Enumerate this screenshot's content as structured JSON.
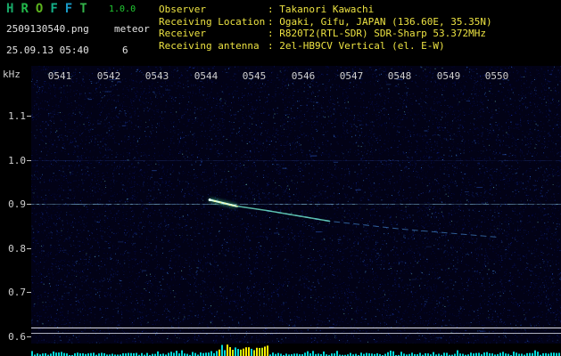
{
  "app": {
    "title_letters": [
      {
        "ch": "H",
        "color": "#18a868"
      },
      {
        "ch": "R",
        "color": "#22b84a"
      },
      {
        "ch": "O",
        "color": "#5cb41e"
      },
      {
        "ch": "F",
        "color": "#14b088"
      },
      {
        "ch": "F",
        "color": "#1898c4"
      },
      {
        "ch": "T",
        "color": "#34b44a"
      }
    ],
    "version": "1.0.0",
    "version_color": "#22cc33",
    "filename": "2509130540.png",
    "mode_label": "meteor",
    "datetime": "25.09.13 05:40",
    "event_count": "6"
  },
  "info": {
    "rows": [
      {
        "label": "Observer",
        "value": ": Takanori Kawachi"
      },
      {
        "label": "Receiving Location",
        "value": ": Ogaki, Gifu, JAPAN (136.60E, 35.35N)"
      },
      {
        "label": "Receiver",
        "value": ": R820T2(RTL-SDR) SDR-Sharp 53.372MHz"
      },
      {
        "label": "Receiving antenna",
        "value": ": 2el-HB9CV Vertical (el. E-W)"
      }
    ]
  },
  "spectrogram": {
    "freq_unit": "kHz",
    "time_labels": [
      "0541",
      "0542",
      "0543",
      "0544",
      "0545",
      "0546",
      "0547",
      "0548",
      "0549",
      "0550"
    ],
    "freq_labels": [
      "1.1",
      "1.0",
      "0.9",
      "0.8",
      "0.7",
      "0.6"
    ],
    "carrier_line_khz": 0.9,
    "faint_line_khz": 1.0,
    "calibration_lines_khz": [
      0.621,
      0.609
    ],
    "echo": {
      "points_time_khz": [
        [
          4.08,
          0.91
        ],
        [
          4.62,
          0.897
        ],
        [
          5.25,
          0.886
        ],
        [
          6.55,
          0.863
        ],
        [
          8.05,
          0.843
        ],
        [
          10.02,
          0.826
        ]
      ]
    },
    "colors": {
      "background": "#020216",
      "noise_blue": "#1424a0",
      "carrier": "#8cd2ff",
      "echo_head": "#d8ffe8",
      "echo_mid": "#6ee6c8",
      "echo_tail": "#55aaff",
      "calibration": "#e6e6ea",
      "axis_text": "#cfcfcf"
    },
    "activity_strip": {
      "bar_color": "#00d8d8",
      "event_color": "#ffee00",
      "event_window_min": [
        4.25,
        5.3
      ]
    }
  }
}
